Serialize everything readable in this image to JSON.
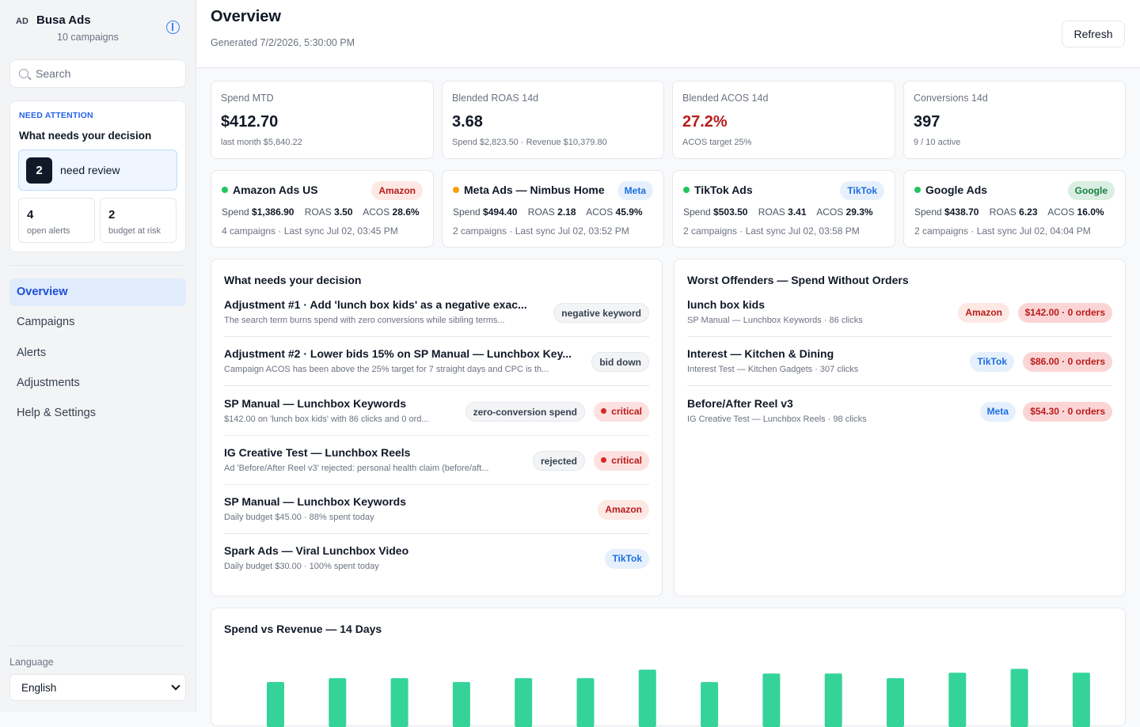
{
  "sidebar": {
    "logo": "AD",
    "brand": "Busa Ads",
    "brand_sub": "10 campaigns",
    "search_placeholder": "Search",
    "attention": {
      "tag": "NEED ATTENTION",
      "title": "What needs your decision",
      "review_count": "2",
      "review_label": "need review",
      "open_alerts": "4",
      "open_alerts_label": "open alerts",
      "budget_risk": "2",
      "budget_risk_label": "budget at risk"
    },
    "nav": [
      "Overview",
      "Campaigns",
      "Alerts",
      "Adjustments",
      "Help & Settings"
    ],
    "language_label": "Language",
    "language_value": "English"
  },
  "header": {
    "title": "Overview",
    "subtitle": "Generated 7/2/2026, 5:30:00 PM",
    "refresh": "Refresh"
  },
  "kpis": [
    {
      "label": "Spend MTD",
      "value": "$412.70",
      "sub": "last month $5,840.22"
    },
    {
      "label": "Blended ROAS 14d",
      "value": "3.68",
      "sub": "Spend $2,823.50 · Revenue $10,379.80"
    },
    {
      "label": "Blended ACOS 14d",
      "value": "27.2%",
      "sub": "ACOS target 25%"
    },
    {
      "label": "Conversions 14d",
      "value": "397",
      "sub": "9 / 10 active"
    }
  ],
  "platforms": [
    {
      "name": "Amazon Ads US",
      "badge": "Amazon",
      "spend": "$1,386.90",
      "roas": "3.50",
      "acos": "28.6%",
      "meta": "4 campaigns · Last sync Jul 02, 03:45 PM",
      "dot": "#22c55e"
    },
    {
      "name": "Meta Ads — Nimbus Home",
      "badge": "Meta",
      "spend": "$494.40",
      "roas": "2.18",
      "acos": "45.9%",
      "meta": "2 campaigns · Last sync Jul 02, 03:52 PM",
      "dot": "#f59e0b"
    },
    {
      "name": "TikTok Ads",
      "badge": "TikTok",
      "spend": "$503.50",
      "roas": "3.41",
      "acos": "29.3%",
      "meta": "2 campaigns · Last sync Jul 02, 03:58 PM",
      "dot": "#22c55e"
    },
    {
      "name": "Google Ads",
      "badge": "Google",
      "spend": "$438.70",
      "roas": "6.23",
      "acos": "16.0%",
      "meta": "2 campaigns · Last sync Jul 02, 04:04 PM",
      "dot": "#22c55e"
    }
  ],
  "labels": {
    "spend": "Spend",
    "roas": "ROAS",
    "acos": "ACOS"
  },
  "decisions": {
    "title": "What needs your decision",
    "rows": [
      {
        "title": "Adjustment #1 · Add 'lunch box kids' as a negative exac...",
        "sub": "The search term burns spend with zero conversions while sibling terms...",
        "tag": "negative keyword"
      },
      {
        "title": "Adjustment #2 · Lower bids 15% on SP Manual — Lunchbox Key...",
        "sub": "Campaign ACOS has been above the 25% target for 7 straight days and CPC is th...",
        "tag": "bid down"
      },
      {
        "title": "SP Manual — Lunchbox Keywords",
        "sub": "$142.00 on 'lunch box kids' with 86 clicks and 0 ord...",
        "tag": "zero-conversion spend",
        "critical": "critical"
      },
      {
        "title": "IG Creative Test — Lunchbox Reels",
        "sub": "Ad 'Before/After Reel v3' rejected: personal health claim (before/aft...",
        "tag": "rejected",
        "critical": "critical"
      },
      {
        "title": "SP Manual — Lunchbox Keywords",
        "sub": "Daily budget $45.00 · 88% spent today",
        "platform": "Amazon"
      },
      {
        "title": "Spark Ads — Viral Lunchbox Video",
        "sub": "Daily budget $30.00 · 100% spent today",
        "platform": "TikTok"
      }
    ]
  },
  "offenders": {
    "title": "Worst Offenders — Spend Without Orders",
    "rows": [
      {
        "title": "lunch box kids",
        "sub": "SP Manual — Lunchbox Keywords · 86 clicks",
        "platform": "Amazon",
        "amount": "$142.00 · 0 orders"
      },
      {
        "title": "Interest — Kitchen & Dining",
        "sub": "Interest Test — Kitchen Gadgets · 307 clicks",
        "platform": "TikTok",
        "amount": "$86.00 · 0 orders"
      },
      {
        "title": "Before/After Reel v3",
        "sub": "IG Creative Test — Lunchbox Reels · 98 clicks",
        "platform": "Meta",
        "amount": "$54.30 · 0 orders"
      }
    ]
  },
  "chart_data": {
    "type": "bar",
    "title": "Spend vs Revenue — 14 Days",
    "series": [
      {
        "values": [
          58,
          63,
          63,
          58,
          63,
          63,
          74,
          58,
          69,
          69,
          63,
          70,
          75,
          70
        ]
      }
    ],
    "colors": {
      "bar": "#34d399"
    }
  }
}
